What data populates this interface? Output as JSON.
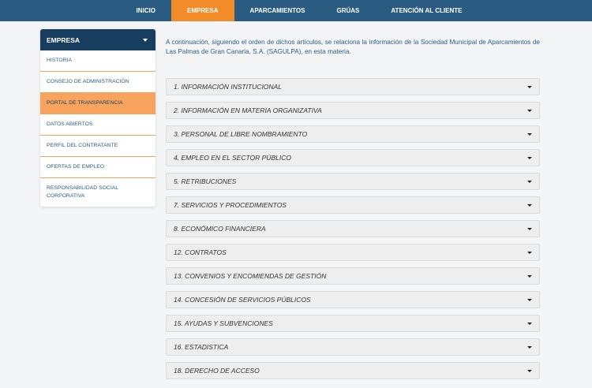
{
  "nav": {
    "items": [
      {
        "label": "INICIO",
        "active": false
      },
      {
        "label": "EMPRESA",
        "active": true
      },
      {
        "label": "APARCAMIENTOS",
        "active": false
      },
      {
        "label": "GRÚAS",
        "active": false
      },
      {
        "label": "ATENCIÓN AL CLIENTE",
        "active": false
      }
    ],
    "active_color": "#f28c28",
    "bar_color": "#2a5c82"
  },
  "sidebar": {
    "title": "EMPRESA",
    "header_icon": "chevron-down-icon",
    "items": [
      {
        "label": "HISTORIA"
      },
      {
        "label": "CONSEJO DE ADMINISTRACIÓN"
      },
      {
        "label": "PORTAL DE TRANSPARENCIA",
        "active": true
      },
      {
        "label": "DATOS ABIERTOS"
      },
      {
        "label": "PERFIL DEL CONTRATANTE"
      },
      {
        "label": "OFERTAS DE EMPLEO"
      },
      {
        "label": "RESPONSABILIDAD SOCIAL CORPORATIVA"
      }
    ]
  },
  "main": {
    "intro": "A continuación, siguiendo el orden de dichos artículos, se relaciona la información de la Sociedad Municipal de Aparcamientos de Las Palmas de Gran Canaria, S.A. (SAGULPA), en esta materia.",
    "sections": [
      {
        "label": "1. INFORMACIÓN INSTITUCIONAL"
      },
      {
        "label": "2. INFORMACIÓN EN MATERIA ORGANIZATIVA"
      },
      {
        "label": "3. PERSONAL DE LIBRE NOMBRAMIENTO"
      },
      {
        "label": "4. EMPLEO EN EL SECTOR PÚBLICO"
      },
      {
        "label": "5. RETRIBUCIONES"
      },
      {
        "label": "7. SERVICIOS Y PROCEDIMIENTOS"
      },
      {
        "label": "8. ECONÓMICO FINANCIERA"
      },
      {
        "label": "12. CONTRATOS"
      },
      {
        "label": "13. CONVENIOS Y ENCOMIENDAS DE GESTIÓN"
      },
      {
        "label": "14. CONCESIÓN DE SERVICIOS PÚBLICOS"
      },
      {
        "label": "15. AYUDAS Y SUBVENCIONES"
      },
      {
        "label": "16. ESTADISTICA"
      },
      {
        "label": "18. DERECHO DE ACCESO"
      }
    ]
  }
}
